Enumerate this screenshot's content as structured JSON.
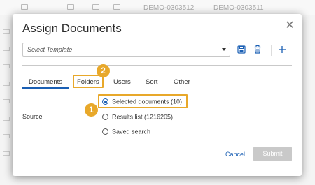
{
  "background": {
    "doc_ids": [
      "DEMO-0303512",
      "DEMO-0303511"
    ]
  },
  "dialog": {
    "title": "Assign Documents",
    "close_icon": "close-icon",
    "template": {
      "placeholder": "Select Template",
      "toolbar_icons": [
        "save-icon",
        "delete-icon",
        "add-icon"
      ]
    },
    "tabs": [
      {
        "label": "Documents",
        "active": true
      },
      {
        "label": "Folders",
        "active": false
      },
      {
        "label": "Users",
        "active": false
      },
      {
        "label": "Sort",
        "active": false
      },
      {
        "label": "Other",
        "active": false
      }
    ],
    "source": {
      "label": "Source",
      "options": [
        {
          "label": "Selected documents (10)",
          "checked": true
        },
        {
          "label": "Results list (1216205)",
          "checked": false
        },
        {
          "label": "Saved search",
          "checked": false
        }
      ]
    },
    "callouts": [
      "1",
      "2"
    ],
    "buttons": {
      "cancel": "Cancel",
      "submit": "Submit"
    }
  },
  "colors": {
    "accent": "#1a5fb4",
    "callout": "#e8a82a",
    "disabled_button": "#c9c9c9"
  }
}
